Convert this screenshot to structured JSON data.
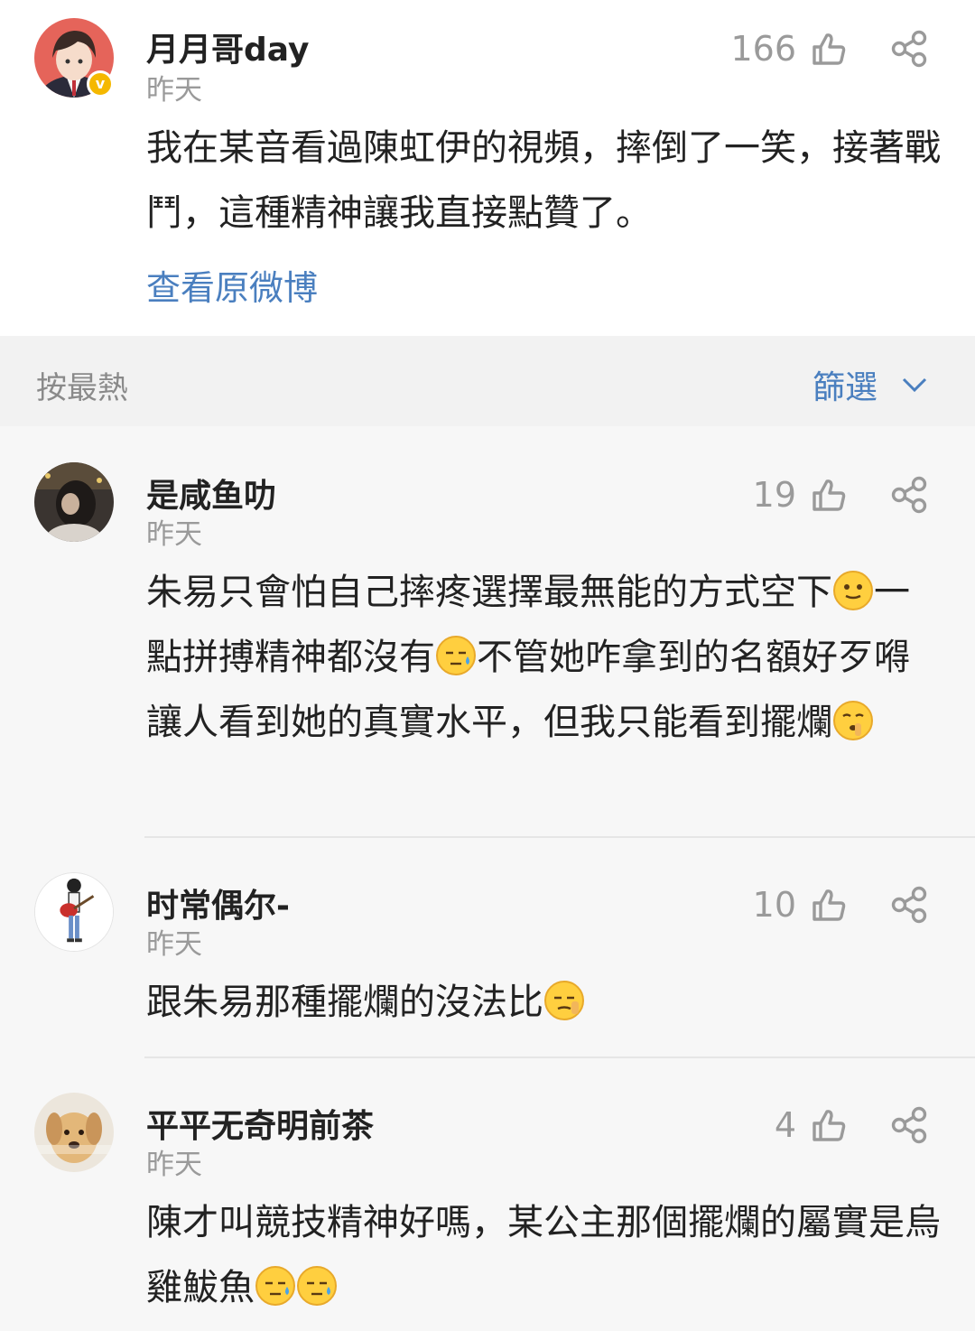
{
  "post": {
    "username": "月月哥day",
    "time": "昨天",
    "like_count": "166",
    "content": "我在某音看過陳虹伊的視頻，摔倒了一笑，接著戰鬥，這種精神讓我直接點贊了。",
    "view_original": "查看原微博",
    "badge": "v"
  },
  "sort_bar": {
    "sort_label": "按最熱",
    "filter_label": "篩選"
  },
  "comments": [
    {
      "username": "是咸鱼叻",
      "time": "昨天",
      "like_count": "19",
      "content_parts": [
        "朱易只會怕自己摔疼選擇最無能的方式空下",
        "一點拼搏精神都沒有",
        "不管她咋拿到的名額好歹嘚讓人看到她的真實水平，但我只能看到擺爛"
      ]
    },
    {
      "username": "时常偶尔-",
      "time": "昨天",
      "like_count": "10",
      "content_parts": [
        "跟朱易那種擺爛的沒法比"
      ]
    },
    {
      "username": "平平无奇明前茶",
      "time": "昨天",
      "like_count": "4",
      "content_parts": [
        "陳才叫競技精神好嗎，某公主那個擺爛的屬實是烏雞鮁魚"
      ]
    }
  ],
  "icons": {
    "like": "thumbs-up-icon",
    "share": "share-icon",
    "filter": "chevron-down-icon"
  },
  "colors": {
    "link": "#4a7fbf",
    "secondary_text": "#9a9a9a",
    "badge": "#f5b800"
  }
}
